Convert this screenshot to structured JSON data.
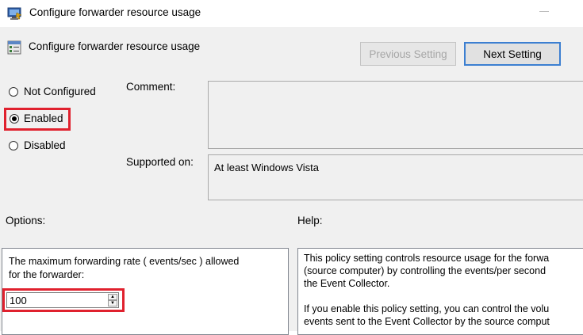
{
  "window": {
    "title": "Configure forwarder resource usage"
  },
  "header": {
    "title": "Configure forwarder resource usage"
  },
  "nav": {
    "previous_label": "Previous Setting",
    "next_label": "Next Setting"
  },
  "state": {
    "options": [
      {
        "label": "Not Configured",
        "selected": false
      },
      {
        "label": "Enabled",
        "selected": true
      },
      {
        "label": "Disabled",
        "selected": false
      }
    ]
  },
  "comment": {
    "label": "Comment:",
    "value": ""
  },
  "supported": {
    "label": "Supported on:",
    "value": "At least Windows Vista"
  },
  "options_section": {
    "label": "Options:",
    "rate_label": "The maximum forwarding rate ( events/sec ) allowed\nfor the forwarder:",
    "rate_value": "100"
  },
  "help_section": {
    "label": "Help:",
    "text": "This policy setting controls resource usage for the forwa\n(source computer) by controlling the events/per second\nthe Event Collector.\n\nIf you enable this policy setting, you can control the volu\nevents sent to the Event Collector by the source comput"
  },
  "colors": {
    "highlight": "#e0212e",
    "accent": "#3c7fd1",
    "background": "#f0f0f0"
  }
}
